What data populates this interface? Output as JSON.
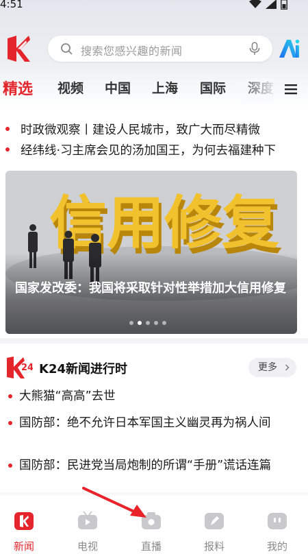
{
  "status_bar": {
    "time": "4:51",
    "icons": [
      "wifi-icon",
      "signal-icon",
      "battery-icon"
    ]
  },
  "header": {
    "search_placeholder": "搜索您感兴趣的新闻",
    "search_icon": "search-icon",
    "mic_icon": "microphone-icon",
    "ai_icon": "ai-assistant-icon",
    "logo": "app-logo"
  },
  "tabs": [
    {
      "label": "精选",
      "active": true
    },
    {
      "label": "视频",
      "active": false
    },
    {
      "label": "中国",
      "active": false
    },
    {
      "label": "上海",
      "active": false
    },
    {
      "label": "国际",
      "active": false
    },
    {
      "label": "深度",
      "active": false
    }
  ],
  "headlines": [
    "时政微观察丨建设人民城市，致广大而尽精微",
    "经纬线·习主席会见的汤加国王，为何去福建种下"
  ],
  "carousel": {
    "image_text": "信用修复",
    "caption": "国家发改委：我国将采取针对性举措加大信用修复",
    "total_slides": 5,
    "active_slide": 2
  },
  "k24_section": {
    "logo_text": "24",
    "title": "K24新闻进行时",
    "more_label": "更多",
    "items": [
      "大熊猫“高高”去世",
      "国防部：绝不允许日本军国主义幽灵再为祸人间",
      "国防部：民进党当局炮制的所谓“手册”谎话连篇"
    ]
  },
  "bottom_nav": [
    {
      "label": "新闻",
      "icon": "news-icon",
      "active": true
    },
    {
      "label": "电视",
      "icon": "tv-icon",
      "active": false
    },
    {
      "label": "直播",
      "icon": "live-camera-icon",
      "active": false
    },
    {
      "label": "报料",
      "icon": "tip-off-icon",
      "active": false
    },
    {
      "label": "我的",
      "icon": "profile-icon",
      "active": false
    }
  ],
  "colors": {
    "accent": "#e4262c",
    "text": "#1c1c1c",
    "inactive": "#8a8a8a",
    "nav_icon_gray": "#c9c9cc"
  },
  "annotation": {
    "icon": "red-arrow-icon",
    "color": "#e8232a"
  }
}
